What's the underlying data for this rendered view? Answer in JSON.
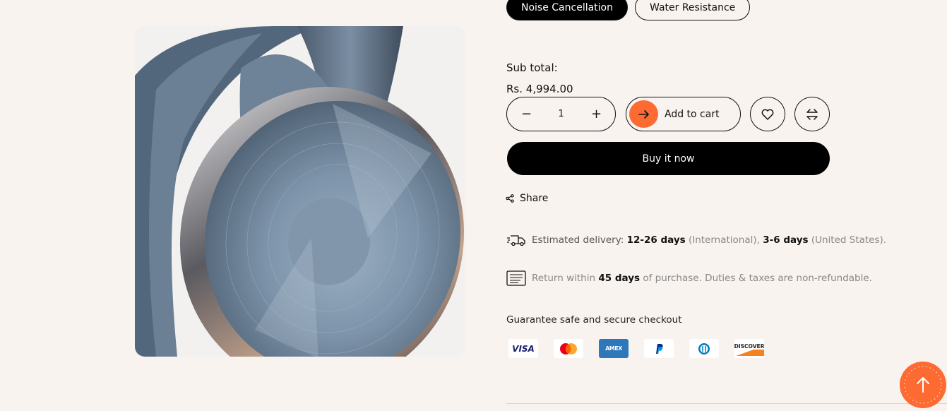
{
  "variants": {
    "options": [
      "Noise Cancellation",
      "Water Resistance"
    ],
    "selected": "Noise Cancellation"
  },
  "subtotal": {
    "label": "Sub total:",
    "price": "Rs. 4,994.00"
  },
  "quantity": {
    "minus": "−",
    "value": "1",
    "plus": "+"
  },
  "add_to_cart": {
    "label": "Add to cart",
    "icon": "arrow-right-icon"
  },
  "wishlist": {
    "icon": "heart-icon"
  },
  "compare": {
    "icon": "compare-arrows-icon"
  },
  "buy_now": {
    "label": "Buy it now"
  },
  "share": {
    "label": "Share",
    "icon": "share-icon"
  },
  "delivery": {
    "icon": "truck-icon",
    "prefix": "Estimated delivery:",
    "intl_days": "12-26 days",
    "intl_label": "(International),",
    "us_days": "3-6 days",
    "us_label": "(United States)."
  },
  "returns": {
    "icon": "receipt-icon",
    "prefix": "Return within",
    "days": "45 days",
    "suffix": "of purchase. Duties & taxes are non-refundable."
  },
  "guarantee": {
    "label": "Guarantee safe and secure checkout"
  },
  "payment_methods": [
    "VISA",
    "Mastercard",
    "AMEX",
    "PayPal",
    "Diners Club",
    "DISCOVER"
  ],
  "colors": {
    "accent": "#fd6b32",
    "background": "#f9f3ef",
    "dark": "#000000"
  }
}
